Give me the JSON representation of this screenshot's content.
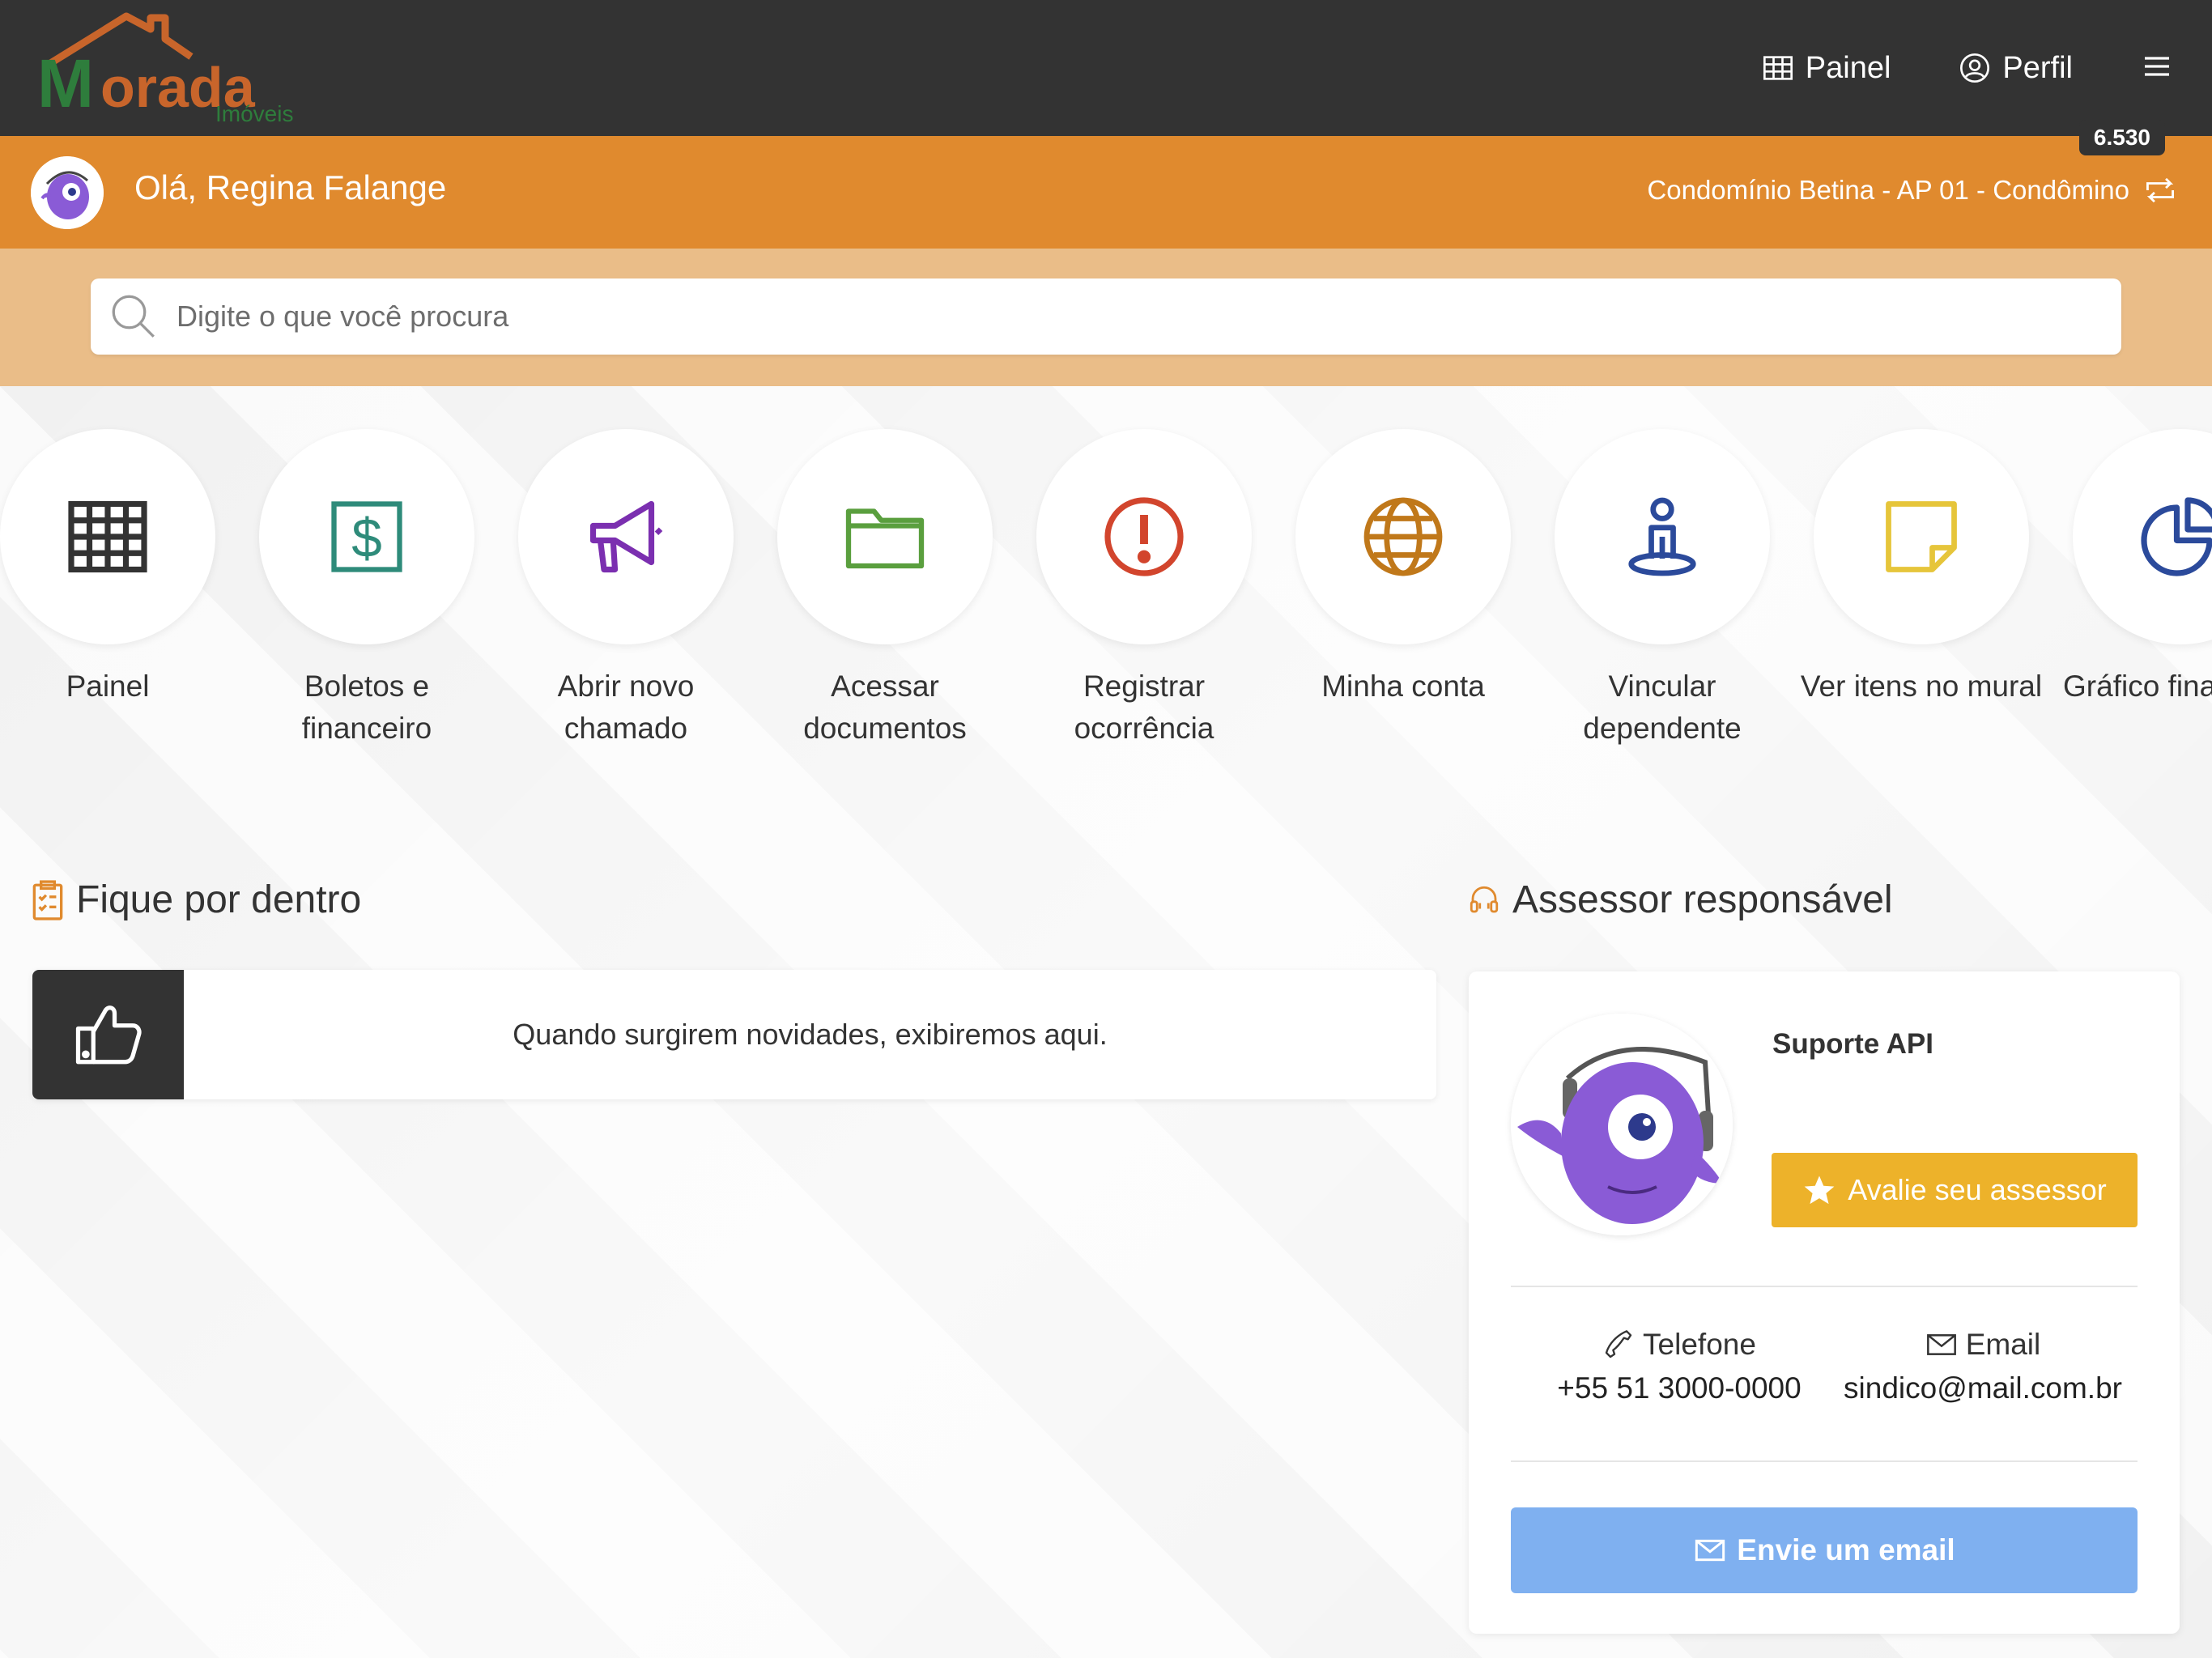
{
  "header": {
    "logo_text": "Morada",
    "logo_subtext": "Imóveis",
    "nav": [
      {
        "label": "Painel",
        "icon": "table-icon"
      },
      {
        "label": "Perfil",
        "icon": "user-circle-icon"
      }
    ],
    "menu_icon": "hamburger-icon"
  },
  "greeting": {
    "text": "Olá, Regina Falange",
    "condo": "Condomínio Betina - AP 01 - Condômino",
    "badge": "6.530"
  },
  "search": {
    "placeholder": "Digite o que você procura"
  },
  "shortcuts": [
    {
      "label": "Painel",
      "icon": "table-icon",
      "color": "#333333"
    },
    {
      "label": "Boletos e financeiro",
      "icon": "dollar-icon",
      "color": "#2e8b7a"
    },
    {
      "label": "Abrir novo chamado",
      "icon": "megaphone-icon",
      "color": "#7b2fb0"
    },
    {
      "label": "Acessar documentos",
      "icon": "folder-icon",
      "color": "#5a9f3e"
    },
    {
      "label": "Registrar ocorrência",
      "icon": "alert-icon",
      "color": "#d2452d"
    },
    {
      "label": "Minha conta",
      "icon": "globe-icon",
      "color": "#c0781a"
    },
    {
      "label": "Vincular dependente",
      "icon": "person-pin-icon",
      "color": "#2b4a9b"
    },
    {
      "label": "Ver itens no mural",
      "icon": "sticky-note-icon",
      "color": "#e6c53a"
    },
    {
      "label": "Gráfico financeiro",
      "icon": "pie-chart-icon",
      "color": "#2b4a9b"
    }
  ],
  "news": {
    "title": "Fique por dentro",
    "empty_text": "Quando surgirem novidades, exibiremos aqui."
  },
  "assessor": {
    "title": "Assessor responsável",
    "name": "Suporte API",
    "rate_label": "Avalie seu assessor",
    "phone_label": "Telefone",
    "phone_value": "+55 51 3000-0000",
    "email_label": "Email",
    "email_value": "sindico@mail.com.br",
    "email_button": "Envie um email"
  },
  "colors": {
    "topbar": "#333333",
    "accent_orange": "#e08a2e",
    "search_band": "#eabd88",
    "rate_button": "#edb22a",
    "email_button": "#7fb0f0"
  }
}
